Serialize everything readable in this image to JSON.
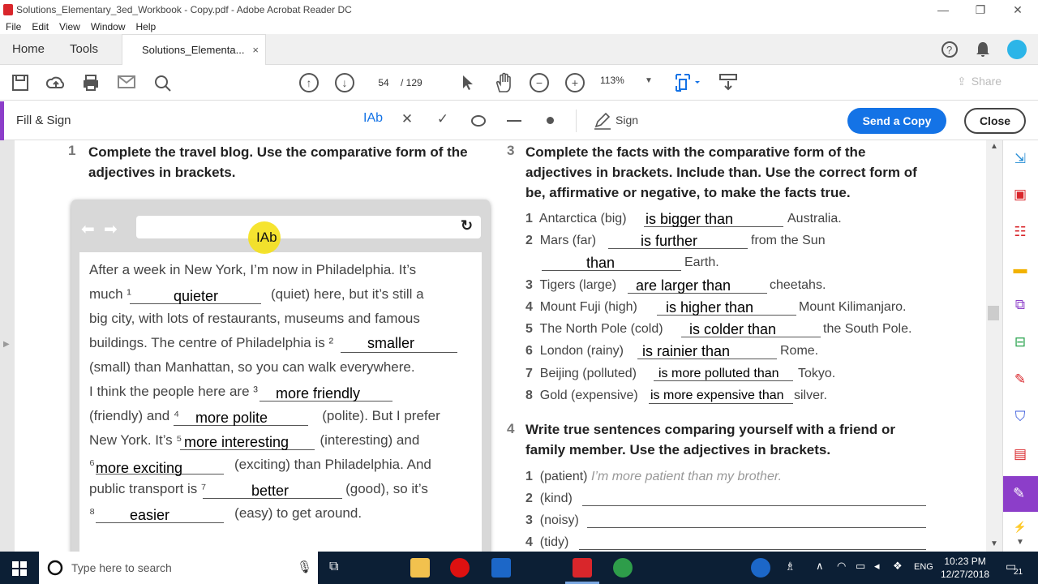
{
  "window": {
    "title": "Solutions_Elementary_3ed_Workbook - Copy.pdf - Adobe Acrobat Reader DC",
    "minimize": "—",
    "restore": "❐",
    "close": "✕"
  },
  "menu": [
    "File",
    "Edit",
    "View",
    "Window",
    "Help"
  ],
  "tabs": {
    "home": "Home",
    "tools": "Tools",
    "document": "Solutions_Elementa...",
    "close": "×"
  },
  "toolbar": {
    "page_current": "54",
    "page_total": "/ 129",
    "zoom": "113%",
    "share": "Share"
  },
  "fillsign": {
    "label": "Fill & Sign",
    "text_tool": "Ab",
    "sign": "Sign",
    "send_copy": "Send a Copy",
    "close": "Close"
  },
  "ex1": {
    "number": "1",
    "heading": [
      "Complete the travel blog. Use the comparative form of the",
      "adjectives in brackets."
    ],
    "cursor_label": "Ab",
    "lines": [
      "After a week in New York, I’m now in Philadelphia. It’s",
      "much ¹",
      "(quiet) here, but it’s still a",
      "big city, with lots of restaurants, museums and famous",
      "buildings. The centre of Philadelphia is ²",
      "(small) than Manhattan, so you can walk everywhere.",
      "I think the people here are ³",
      "(friendly) and ⁴",
      "(polite). But I prefer",
      "New York. It’s ⁵",
      "(interesting) and",
      "⁶",
      "(exciting) than Philadelphia. And",
      "public transport is ⁷",
      "(good), so it’s",
      "⁸",
      "(easy) to get around."
    ],
    "answers": [
      "quieter",
      "smaller",
      "more friendly",
      "more polite",
      "more interesting",
      "more exciting",
      "better",
      "easier"
    ]
  },
  "ex3": {
    "number": "3",
    "heading": [
      "Complete the facts with the comparative form of the",
      "adjectives in brackets. Include than. Use the correct form of",
      "be, affirmative or negative, to make the facts true."
    ],
    "items": [
      {
        "n": "1",
        "prompt": "Antarctica (big)",
        "answer": "is bigger than",
        "end": "Australia."
      },
      {
        "n": "2",
        "prompt": "Mars (far)",
        "answer": "is further",
        "end": "from the Sun"
      },
      {
        "n": "",
        "prompt": "",
        "answer": "than",
        "end": "Earth."
      },
      {
        "n": "3",
        "prompt": "Tigers (large)",
        "answer": "are larger than",
        "end": "cheetahs."
      },
      {
        "n": "4",
        "prompt": "Mount Fuji (high)",
        "answer": "is higher than",
        "end": "Mount Kilimanjaro."
      },
      {
        "n": "5",
        "prompt": "The North Pole (cold)",
        "answer": "is colder than",
        "end": "the South Pole."
      },
      {
        "n": "6",
        "prompt": "London (rainy)",
        "answer": "is rainier than",
        "end": "Rome."
      },
      {
        "n": "7",
        "prompt": "Beijing (polluted)",
        "answer": "is more polluted than",
        "end": "Tokyo."
      },
      {
        "n": "8",
        "prompt": "Gold (expensive)",
        "answer": "is more expensive than",
        "end": "silver."
      }
    ]
  },
  "ex4": {
    "number": "4",
    "heading": [
      "Write true sentences comparing yourself with a friend or",
      "family member. Use the adjectives in brackets."
    ],
    "items": [
      {
        "n": "1",
        "prompt": "(patient)",
        "example": "I’m more patient than my brother."
      },
      {
        "n": "2",
        "prompt": "(kind)"
      },
      {
        "n": "3",
        "prompt": "(noisy)"
      },
      {
        "n": "4",
        "prompt": "(tidy)"
      }
    ]
  },
  "taskbar": {
    "search_placeholder": "Type here to search",
    "lang": "ENG",
    "time": "10:23 PM",
    "date": "12/27/2018",
    "notif": "21"
  },
  "colors": {
    "accent_blue": "#1473e6",
    "fill_sign_purple": "#8c3ec9",
    "cursor_yellow": "#f5e11a",
    "taskbar": "#0c1f35"
  }
}
